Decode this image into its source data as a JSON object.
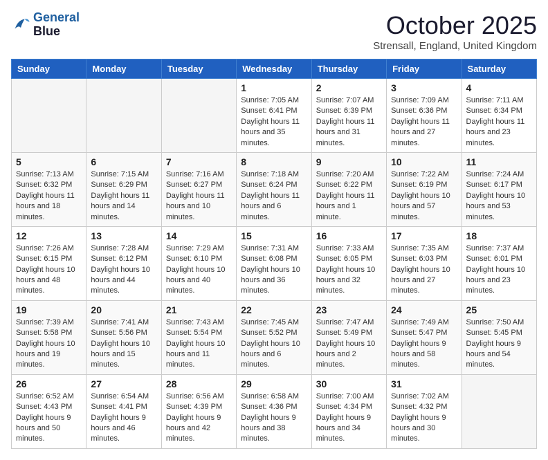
{
  "header": {
    "logo_line1": "General",
    "logo_line2": "Blue",
    "month": "October 2025",
    "location": "Strensall, England, United Kingdom"
  },
  "days_of_week": [
    "Sunday",
    "Monday",
    "Tuesday",
    "Wednesday",
    "Thursday",
    "Friday",
    "Saturday"
  ],
  "weeks": [
    [
      {
        "day": "",
        "empty": true
      },
      {
        "day": "",
        "empty": true
      },
      {
        "day": "",
        "empty": true
      },
      {
        "day": "1",
        "sunrise": "7:05 AM",
        "sunset": "6:41 PM",
        "daylight": "11 hours and 35 minutes."
      },
      {
        "day": "2",
        "sunrise": "7:07 AM",
        "sunset": "6:39 PM",
        "daylight": "11 hours and 31 minutes."
      },
      {
        "day": "3",
        "sunrise": "7:09 AM",
        "sunset": "6:36 PM",
        "daylight": "11 hours and 27 minutes."
      },
      {
        "day": "4",
        "sunrise": "7:11 AM",
        "sunset": "6:34 PM",
        "daylight": "11 hours and 23 minutes."
      }
    ],
    [
      {
        "day": "5",
        "sunrise": "7:13 AM",
        "sunset": "6:32 PM",
        "daylight": "11 hours and 18 minutes."
      },
      {
        "day": "6",
        "sunrise": "7:15 AM",
        "sunset": "6:29 PM",
        "daylight": "11 hours and 14 minutes."
      },
      {
        "day": "7",
        "sunrise": "7:16 AM",
        "sunset": "6:27 PM",
        "daylight": "11 hours and 10 minutes."
      },
      {
        "day": "8",
        "sunrise": "7:18 AM",
        "sunset": "6:24 PM",
        "daylight": "11 hours and 6 minutes."
      },
      {
        "day": "9",
        "sunrise": "7:20 AM",
        "sunset": "6:22 PM",
        "daylight": "11 hours and 1 minute."
      },
      {
        "day": "10",
        "sunrise": "7:22 AM",
        "sunset": "6:19 PM",
        "daylight": "10 hours and 57 minutes."
      },
      {
        "day": "11",
        "sunrise": "7:24 AM",
        "sunset": "6:17 PM",
        "daylight": "10 hours and 53 minutes."
      }
    ],
    [
      {
        "day": "12",
        "sunrise": "7:26 AM",
        "sunset": "6:15 PM",
        "daylight": "10 hours and 48 minutes."
      },
      {
        "day": "13",
        "sunrise": "7:28 AM",
        "sunset": "6:12 PM",
        "daylight": "10 hours and 44 minutes."
      },
      {
        "day": "14",
        "sunrise": "7:29 AM",
        "sunset": "6:10 PM",
        "daylight": "10 hours and 40 minutes."
      },
      {
        "day": "15",
        "sunrise": "7:31 AM",
        "sunset": "6:08 PM",
        "daylight": "10 hours and 36 minutes."
      },
      {
        "day": "16",
        "sunrise": "7:33 AM",
        "sunset": "6:05 PM",
        "daylight": "10 hours and 32 minutes."
      },
      {
        "day": "17",
        "sunrise": "7:35 AM",
        "sunset": "6:03 PM",
        "daylight": "10 hours and 27 minutes."
      },
      {
        "day": "18",
        "sunrise": "7:37 AM",
        "sunset": "6:01 PM",
        "daylight": "10 hours and 23 minutes."
      }
    ],
    [
      {
        "day": "19",
        "sunrise": "7:39 AM",
        "sunset": "5:58 PM",
        "daylight": "10 hours and 19 minutes."
      },
      {
        "day": "20",
        "sunrise": "7:41 AM",
        "sunset": "5:56 PM",
        "daylight": "10 hours and 15 minutes."
      },
      {
        "day": "21",
        "sunrise": "7:43 AM",
        "sunset": "5:54 PM",
        "daylight": "10 hours and 11 minutes."
      },
      {
        "day": "22",
        "sunrise": "7:45 AM",
        "sunset": "5:52 PM",
        "daylight": "10 hours and 6 minutes."
      },
      {
        "day": "23",
        "sunrise": "7:47 AM",
        "sunset": "5:49 PM",
        "daylight": "10 hours and 2 minutes."
      },
      {
        "day": "24",
        "sunrise": "7:49 AM",
        "sunset": "5:47 PM",
        "daylight": "9 hours and 58 minutes."
      },
      {
        "day": "25",
        "sunrise": "7:50 AM",
        "sunset": "5:45 PM",
        "daylight": "9 hours and 54 minutes."
      }
    ],
    [
      {
        "day": "26",
        "sunrise": "6:52 AM",
        "sunset": "4:43 PM",
        "daylight": "9 hours and 50 minutes."
      },
      {
        "day": "27",
        "sunrise": "6:54 AM",
        "sunset": "4:41 PM",
        "daylight": "9 hours and 46 minutes."
      },
      {
        "day": "28",
        "sunrise": "6:56 AM",
        "sunset": "4:39 PM",
        "daylight": "9 hours and 42 minutes."
      },
      {
        "day": "29",
        "sunrise": "6:58 AM",
        "sunset": "4:36 PM",
        "daylight": "9 hours and 38 minutes."
      },
      {
        "day": "30",
        "sunrise": "7:00 AM",
        "sunset": "4:34 PM",
        "daylight": "9 hours and 34 minutes."
      },
      {
        "day": "31",
        "sunrise": "7:02 AM",
        "sunset": "4:32 PM",
        "daylight": "9 hours and 30 minutes."
      },
      {
        "day": "",
        "empty": true
      }
    ]
  ]
}
